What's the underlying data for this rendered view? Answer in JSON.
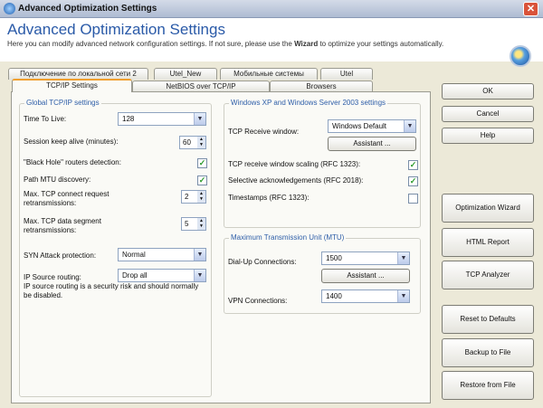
{
  "window": {
    "title": "Advanced Optimization Settings",
    "close": "✕"
  },
  "header": {
    "title": "Advanced Optimization Settings",
    "desc_pre": "Here you can modify advanced network configuration settings. If not sure, please use the ",
    "desc_bold": "Wizard",
    "desc_post": " to optimize your settings automatically."
  },
  "tabs": {
    "row1": [
      "Подключение по локальной сети 2",
      "Utel_New",
      "Мобильные системы",
      "Utel"
    ],
    "row2": [
      "TCP/IP Settings",
      "NetBIOS over TCP/IP",
      "Browsers"
    ],
    "active": "TCP/IP Settings"
  },
  "global": {
    "title": "Global TCP/IP settings",
    "ttl_label": "Time To Live:",
    "ttl": "128",
    "keepalive_label": "Session keep alive (minutes):",
    "keepalive": "60",
    "blackhole_label": "\"Black Hole\" routers detection:",
    "blackhole": true,
    "pmtu_label": "Path MTU discovery:",
    "pmtu": true,
    "connect_label": "Max. TCP connect request retransmissions:",
    "connect": "2",
    "data_label": "Max. TCP data segment retransmissions:",
    "data": "5",
    "syn_label": "SYN Attack protection:",
    "syn": "Normal",
    "iproute_label": "IP Source routing:",
    "iproute": "Drop all",
    "iproute_note": "IP source routing is a security risk and should normally be disabled."
  },
  "xp": {
    "title": "Windows XP and Windows Server 2003 settings",
    "rwin_label": "TCP Receive window:",
    "rwin": "Windows Default",
    "assistant": "Assistant ...",
    "scaling_label": "TCP receive window scaling (RFC 1323):",
    "scaling": true,
    "sack_label": "Selective acknowledgements (RFC 2018):",
    "sack": true,
    "ts_label": "Timestamps (RFC 1323):",
    "ts": false
  },
  "mtu": {
    "title": "Maximum Transmission Unit (MTU)",
    "dialup_label": "Dial-Up Connections:",
    "dialup": "1500",
    "assistant": "Assistant ...",
    "vpn_label": "VPN Connections:",
    "vpn": "1400"
  },
  "buttons": {
    "ok": "OK",
    "cancel": "Cancel",
    "help": "Help",
    "wizard": "Optimization Wizard",
    "html": "HTML Report",
    "analyzer": "TCP Analyzer",
    "reset": "Reset to Defaults",
    "backup": "Backup to File",
    "restore": "Restore from File"
  }
}
